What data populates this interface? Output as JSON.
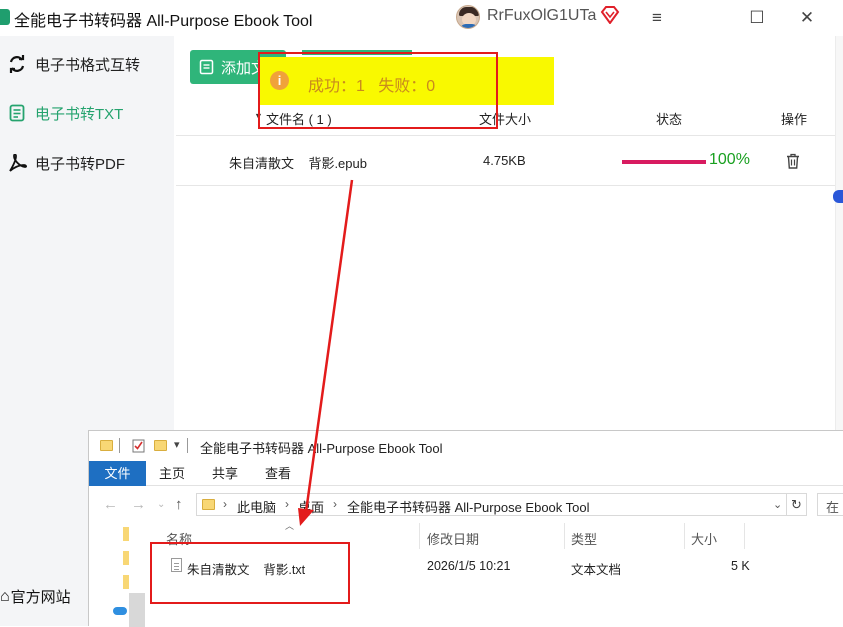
{
  "app": {
    "title": "全能电子书转码器 All-Purpose Ebook Tool",
    "user_name": "RrFuxOlG1UTa",
    "brand_color": "#2fb57a"
  },
  "window_controls": {
    "menu_icon": "≡",
    "maximize_icon": "☐",
    "close_icon": "✕"
  },
  "sidebar": {
    "items": [
      {
        "label": "电子书格式互转",
        "icon": "sync-icon",
        "active": false
      },
      {
        "label": "电子书转TXT",
        "icon": "txt-document-icon",
        "active": true
      },
      {
        "label": "电子书转PDF",
        "icon": "pdf-icon",
        "active": false
      }
    ],
    "site_link": "官方网站"
  },
  "toolbar": {
    "add_label": "添加文"
  },
  "toast": {
    "text": "成功：1   失败：0",
    "icon": "info-icon",
    "text_color": "#c98a1e"
  },
  "table": {
    "headers": {
      "name": "文件名 ( 1 )",
      "size": "文件大小",
      "status": "状态",
      "action": "操作"
    },
    "rows": [
      {
        "name": "朱自清散文    背影.epub",
        "size": "4.75KB",
        "progress": 1.0,
        "progress_label": "100%",
        "action_icon": "trash-icon"
      }
    ]
  },
  "explorer": {
    "title": "全能电子书转码器 All-Purpose Ebook Tool",
    "ribbon_tabs": [
      "文件",
      "主页",
      "共享",
      "查看"
    ],
    "breadcrumb": [
      "此电脑",
      "桌面",
      "全能电子书转码器 All-Purpose Ebook Tool"
    ],
    "search_placeholder": "在",
    "columns": {
      "name": "名称",
      "modified": "修改日期",
      "type": "类型",
      "size": "大小"
    },
    "files": [
      {
        "name": "朱自清散文    背影.txt",
        "modified": "2026/1/5 10:21",
        "type": "文本文档",
        "size": "5 K"
      }
    ]
  }
}
